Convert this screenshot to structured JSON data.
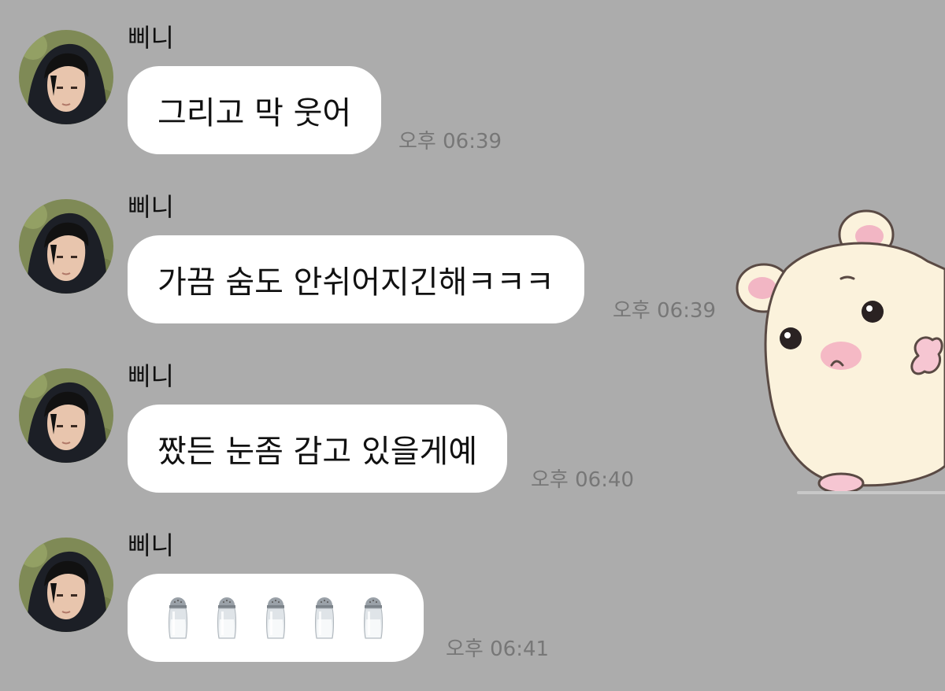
{
  "messages": [
    {
      "sender": "삐니",
      "text": "그리고 막 웃어",
      "time": "오후 06:39"
    },
    {
      "sender": "삐니",
      "text": "가끔 숨도 안쉬어지긴해ㅋㅋㅋ",
      "time": "오후 06:39"
    },
    {
      "sender": "삐니",
      "text": "짰든 눈좀 감고 있을게예",
      "time": "오후 06:40"
    },
    {
      "sender": "삐니",
      "emoji": [
        "salt-shaker",
        "salt-shaker",
        "salt-shaker",
        "salt-shaker",
        "salt-shaker"
      ],
      "time": "오후 06:41"
    }
  ],
  "sticker": {
    "icon": "hamster-sticker"
  },
  "colors": {
    "background": "#acacac",
    "bubble": "#ffffff",
    "time_text": "#777777"
  }
}
